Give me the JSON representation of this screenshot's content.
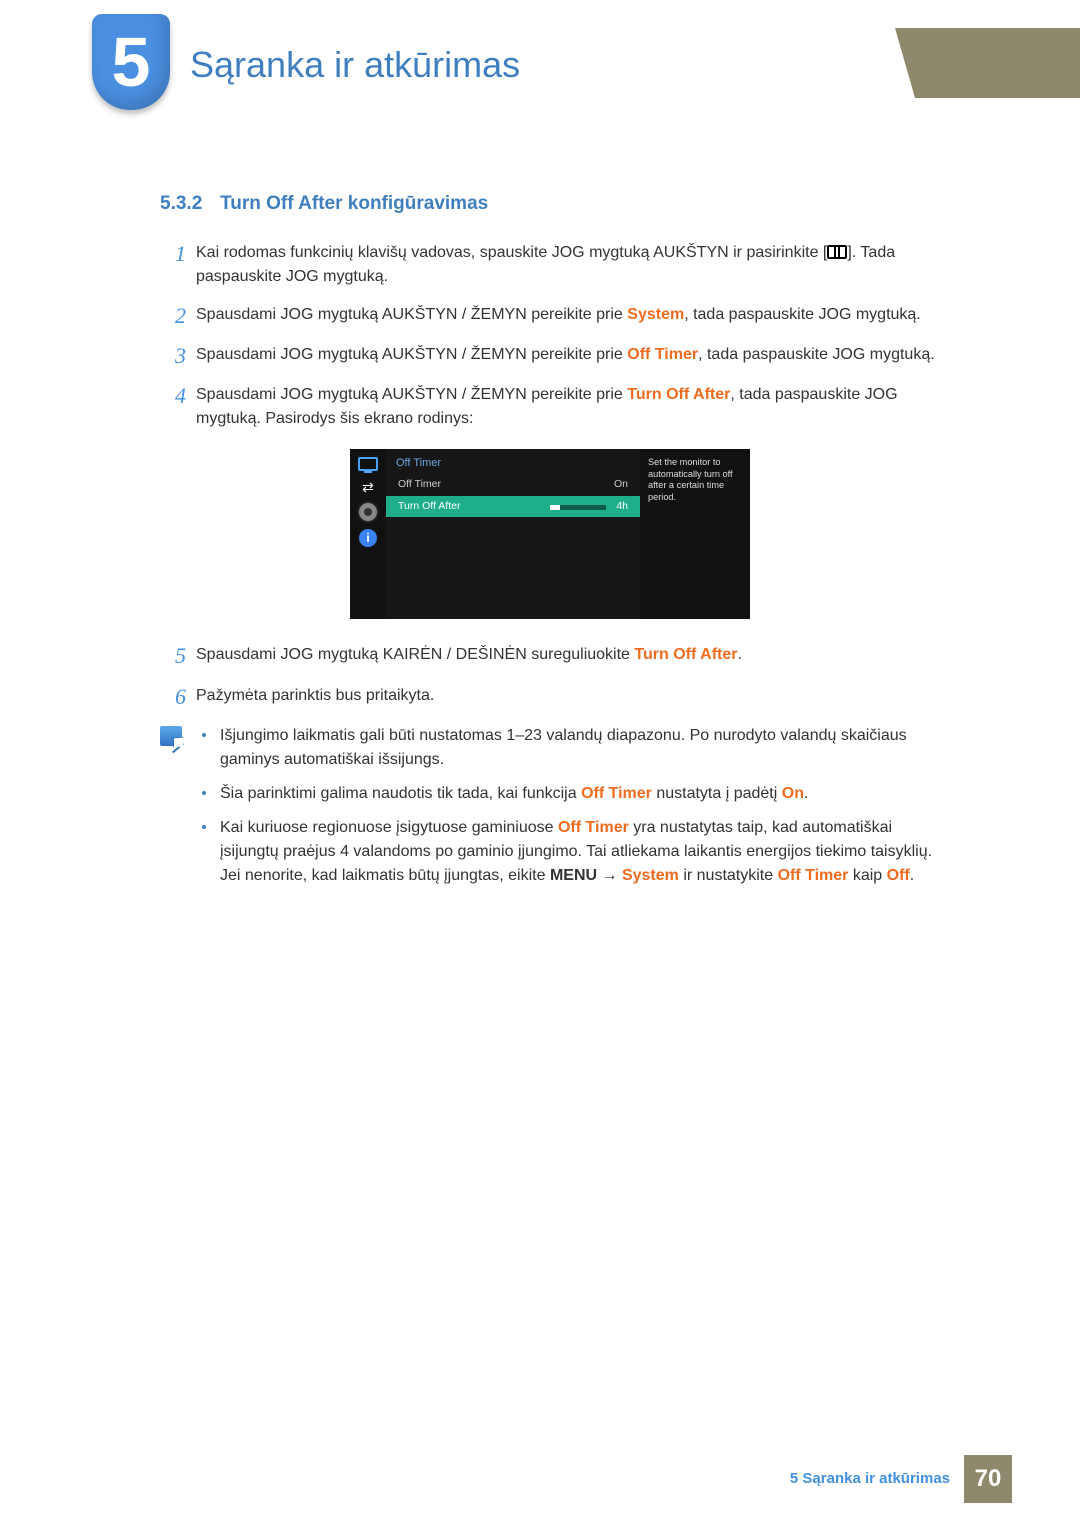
{
  "chapter": {
    "number": "5",
    "title": "Sąranka ir atkūrimas"
  },
  "section": {
    "number": "5.3.2",
    "title": "Turn Off After konfigūravimas"
  },
  "steps": {
    "s1a": "Kai rodomas funkcinių klavišų vadovas, spauskite JOG mygtuką AUKŠTYN ir pasirinkite [",
    "s1b": "]. Tada paspauskite JOG mygtuką.",
    "s2a": "Spausdami JOG mygtuką AUKŠTYN / ŽEMYN pereikite prie ",
    "s2_kw": "System",
    "s2b": ", tada paspauskite JOG mygtuką.",
    "s3a": "Spausdami JOG mygtuką AUKŠTYN / ŽEMYN pereikite prie ",
    "s3_kw": "Off Timer",
    "s3b": ", tada paspauskite JOG mygtuką.",
    "s4a": "Spausdami JOG mygtuką AUKŠTYN / ŽEMYN pereikite prie ",
    "s4_kw": "Turn Off After",
    "s4b": ", tada paspauskite JOG mygtuką. Pasirodys šis ekrano rodinys:",
    "s5a": "Spausdami JOG mygtuką KAIRĖN / DEŠINĖN sureguliuokite ",
    "s5_kw": "Turn Off After",
    "s5b": ".",
    "s6": "Pažymėta parinktis bus pritaikyta."
  },
  "osd": {
    "title": "Off Timer",
    "row1_label": "Off Timer",
    "row1_value": "On",
    "row2_label": "Turn Off After",
    "row2_value": "4h",
    "help": "Set the monitor to automatically turn off after a certain time period."
  },
  "notes": {
    "b1": "Išjungimo laikmatis gali būti nustatomas 1–23 valandų diapazonu. Po nurodyto valandų skaičiaus gaminys automatiškai išsijungs.",
    "b2a": "Šia parinktimi galima naudotis tik tada, kai funkcija ",
    "b2_kw1": "Off Timer",
    "b2b": " nustatyta į padėtį ",
    "b2_kw2": "On",
    "b2c": ".",
    "b3a": "Kai kuriuose regionuose įsigytuose gaminiuose ",
    "b3_kw1": "Off Timer",
    "b3b": " yra nustatytas taip, kad automatiškai įsijungtų praėjus 4 valandoms po gaminio įjungimo. Tai atliekama laikantis energijos tiekimo taisyklių. Jei nenorite, kad laikmatis būtų įjungtas, eikite ",
    "b3_kw2": "MENU",
    "b3_arrow": " → ",
    "b3_kw3": "System",
    "b3c": " ir nustatykite ",
    "b3_kw4": "Off Timer",
    "b3d": " kaip ",
    "b3_kw5": "Off",
    "b3e": "."
  },
  "footer": {
    "text": "5 Sąranka ir atkūrimas",
    "page": "70"
  },
  "nums": {
    "n1": "1",
    "n2": "2",
    "n3": "3",
    "n4": "4",
    "n5": "5",
    "n6": "6"
  },
  "info_glyph": "i"
}
